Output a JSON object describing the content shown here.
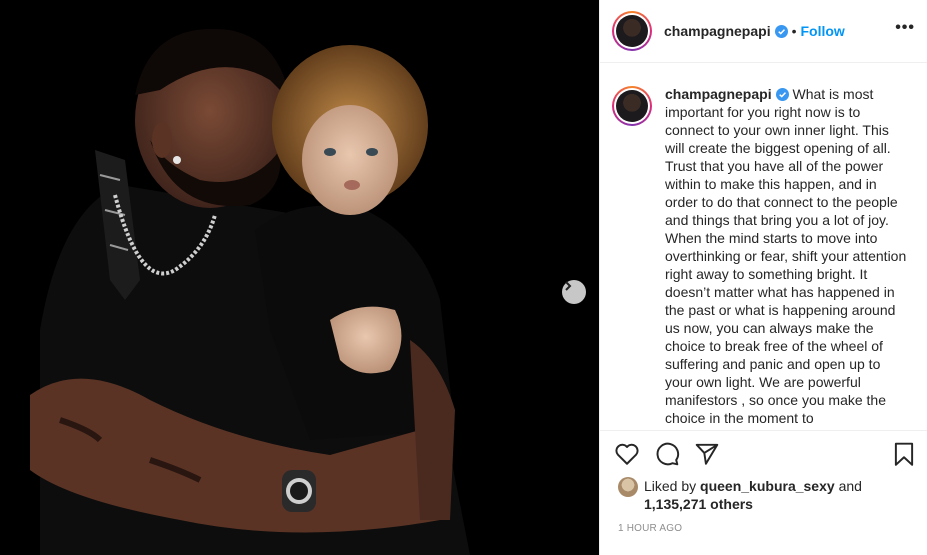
{
  "post": {
    "username": "champagnepapi",
    "follow_label": "Follow",
    "separator": "•",
    "more_label": "•••",
    "caption": "What is most important for you right now is to connect to your own inner light. This will create the biggest opening of all. Trust that you have all of the power within to make this happen, and in order to do that connect to the people and things that bring you a lot of joy. When the mind starts to move into overthinking or fear, shift your attention right away to something bright. It doesn’t matter what has happened in the past or what is happening around us now, you can always make the choice to break free of the wheel of suffering and panic and open up to your own light. We are powerful manifestors , so once you make the choice in the moment to",
    "likes": {
      "prefix": "Liked by",
      "liker": "queen_kubura_sexy",
      "middle": "and",
      "count": "1,135,271 others"
    },
    "timestamp": "1 HOUR AGO"
  },
  "icons": {
    "verified": "verified-badge-icon",
    "like": "heart-icon",
    "comment": "comment-icon",
    "share": "paper-plane-icon",
    "save": "bookmark-icon",
    "next": "chevron-right-icon"
  },
  "colors": {
    "link": "#0095f6",
    "text": "#262626",
    "muted": "#8e8e8e",
    "verified": "#3897f0"
  }
}
